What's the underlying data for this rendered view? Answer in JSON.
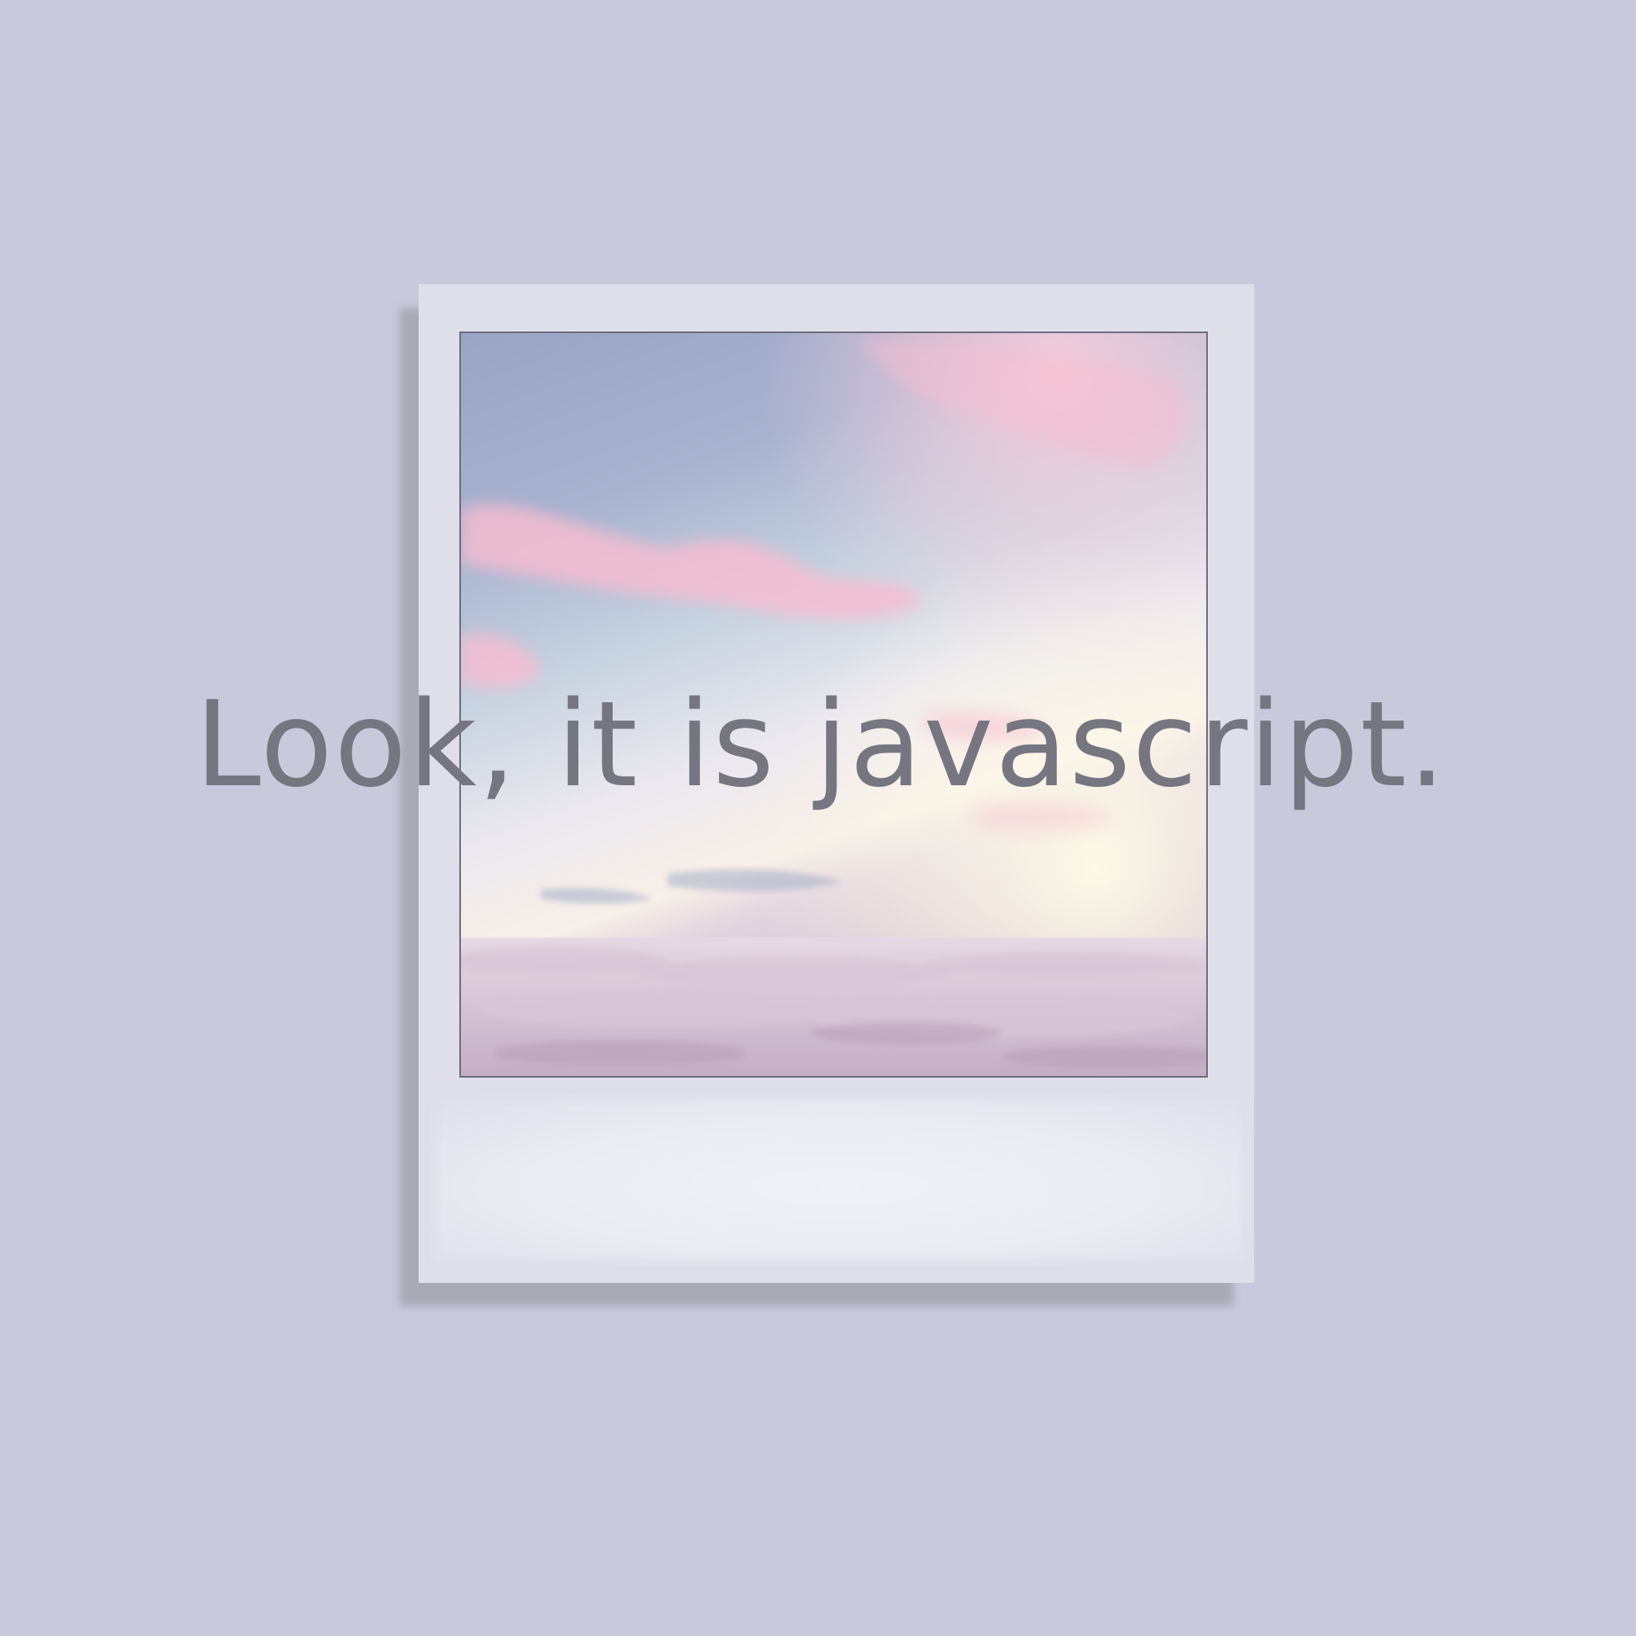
{
  "headline": "Look, it is javascript.",
  "colors": {
    "background": "#c9c9dc",
    "frame": "#dfdfea",
    "text": "#767680"
  },
  "photo": {
    "subject": "sky-above-clouds-icon"
  }
}
